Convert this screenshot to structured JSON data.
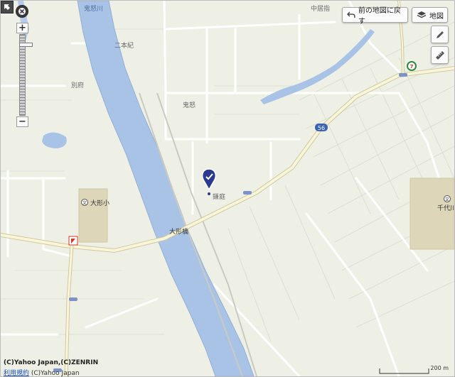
{
  "map": {
    "labels": {
      "river": "鬼怒川",
      "nakaibori": "中居指",
      "nihongi": "二本紀",
      "beppu": "別府",
      "kinu": "鬼怒",
      "kamaniwa": "鎌庭",
      "bridge": "大形橋",
      "school_left": "大形小",
      "school_right": "千代川",
      "route": "56"
    },
    "colors": {
      "land": "#eef0e6",
      "river": "#a9c3e6",
      "major_road": "#f8f5d8",
      "road": "#ffffff",
      "field_line": "#d9dbd2",
      "marker": "#2b3a8e"
    }
  },
  "controls": {
    "back_button_label": "前の地図に戻す",
    "map_button_label": "地図",
    "pencil_tool": "pencil-icon",
    "ruler_tool": "ruler-icon",
    "zoom_in": "+",
    "zoom_out": "−",
    "zoom_level_fraction": 0.1
  },
  "footer": {
    "copyright": "(C)Yahoo Japan,(C)ZENRIN",
    "terms": "利用規約",
    "copyright2": " (C)Yahoo Japan",
    "scale": "200 m"
  }
}
